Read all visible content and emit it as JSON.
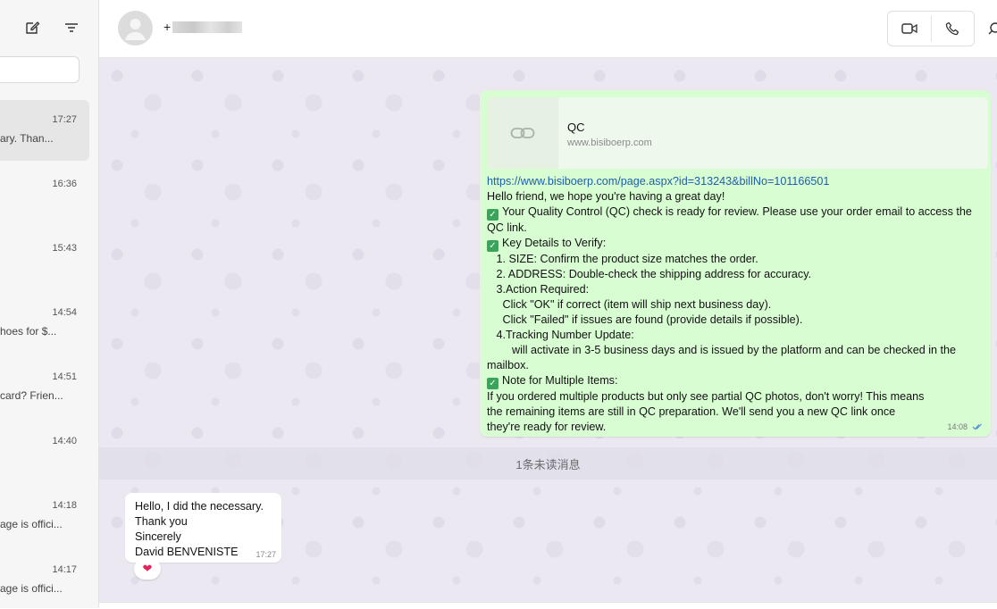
{
  "sidebar": {
    "compose_icon": "compose-icon",
    "filter_icon": "filter-icon",
    "chats": [
      {
        "time": "17:27",
        "preview": "ary.  Than..."
      },
      {
        "time": "16:36",
        "preview": ""
      },
      {
        "time": "15:43",
        "preview": ""
      },
      {
        "time": "14:54",
        "preview": "hoes for $..."
      },
      {
        "time": "14:51",
        "preview": "card? Frien..."
      },
      {
        "time": "14:40",
        "preview": ""
      },
      {
        "time": "14:18",
        "preview": "age is offici..."
      },
      {
        "time": "14:17",
        "preview": "age is offici..."
      }
    ]
  },
  "header": {
    "contact_prefix": "+",
    "video_icon": "video-call-icon",
    "phone_icon": "phone-call-icon",
    "search_icon": "search-icon"
  },
  "outgoing": {
    "link_title": "QC",
    "link_domain": "www.bisiboerp.com",
    "url": "https://www.bisiboerp.com/page.aspx?id=313243&billNo=101166501",
    "lines": {
      "l1": "Hello friend, we hope you're having a great day!",
      "l2": "Your Quality Control (QC) check is ready for review. Please use your order email to access the QC link.",
      "l3": "Key Details to Verify:",
      "l4": "   1. SIZE: Confirm the product size matches the order.",
      "l5": "   2. ADDRESS: Double-check the shipping address for accuracy.",
      "l6": "   3.Action Required:",
      "l7": "     Click \"OK\" if correct (item will ship next business day).",
      "l8": "     Click \"Failed\" if issues are found (provide details if possible).",
      "l9": "   4.Tracking Number Update:",
      "l10": "        will activate in 3-5 business days and is issued by the platform and can be checked in the mailbox.",
      "l11": "Note for Multiple Items:",
      "l12": "If you ordered multiple products but only see partial QC photos, don't worry! This means the remaining items are still in QC preparation. We'll send you a new QC link once they're ready for review."
    },
    "time": "14:08",
    "status_icon": "double-check-icon"
  },
  "divider": {
    "label": "1条未读消息"
  },
  "incoming": {
    "line1": "Hello, I did the necessary.",
    "line2": "Thank you",
    "line3": "Sincerely",
    "line4": "David BENVENISTE",
    "time": "17:27",
    "reaction": "❤"
  }
}
